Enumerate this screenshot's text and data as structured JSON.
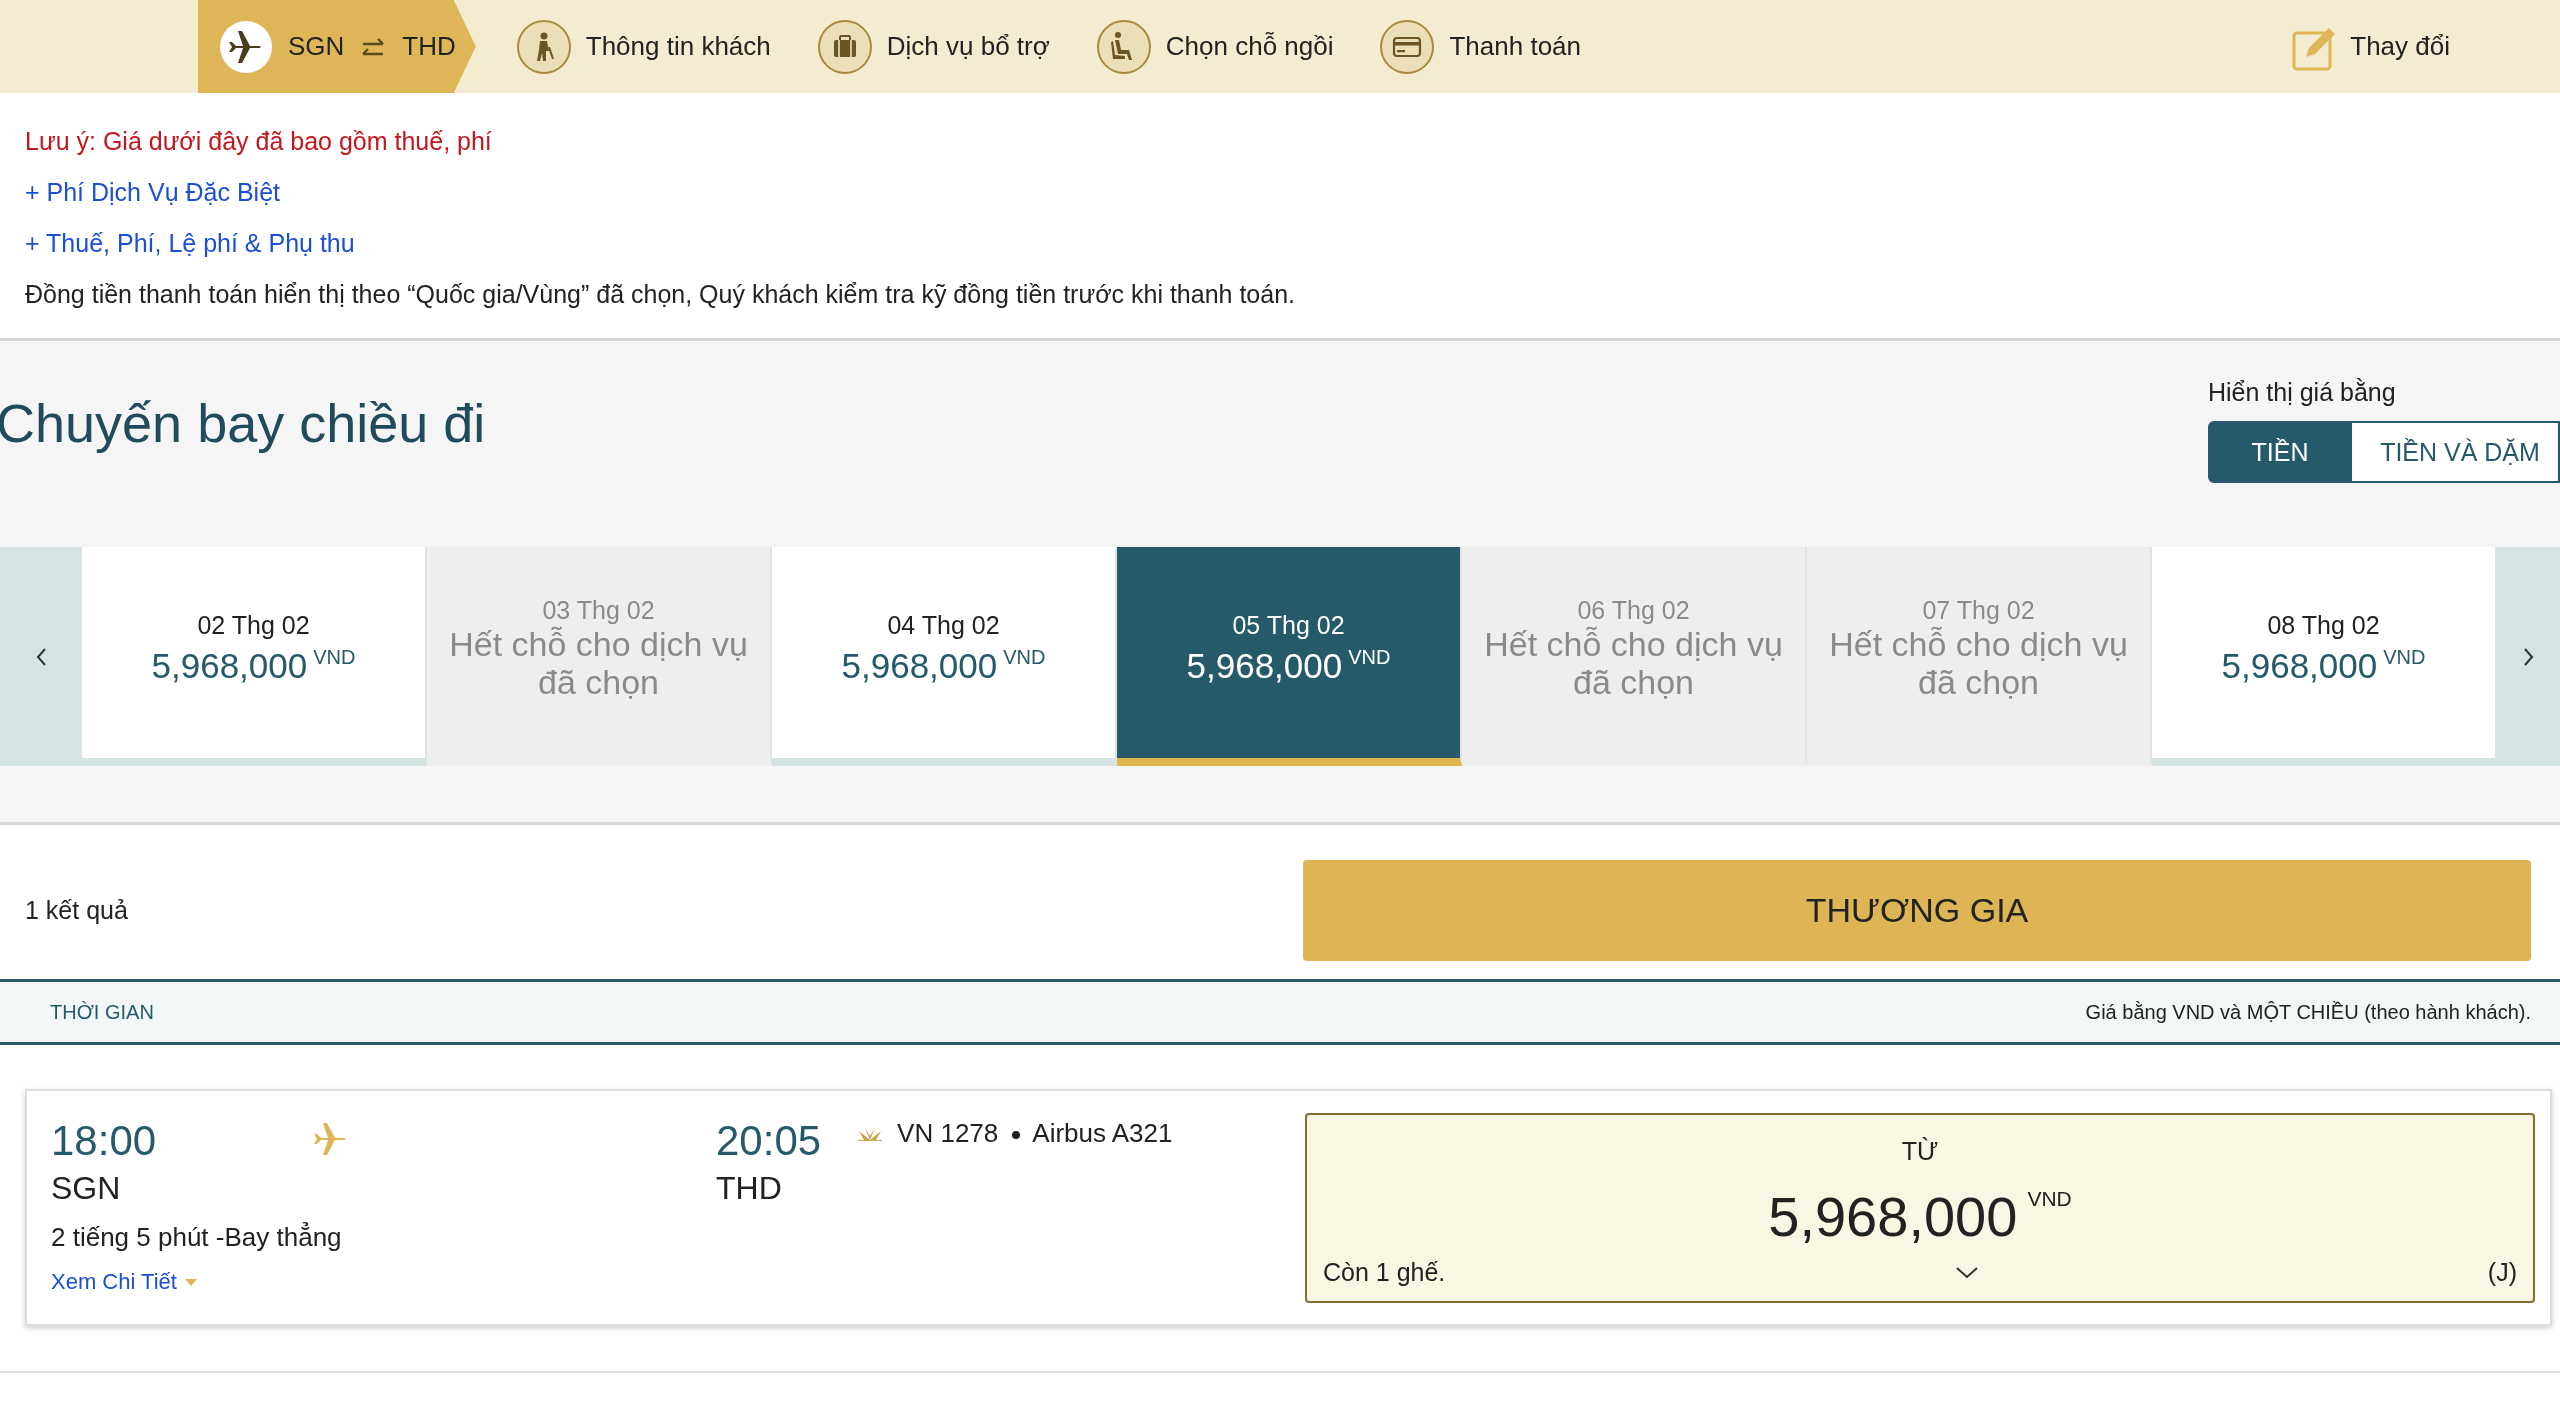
{
  "steps": {
    "route": {
      "from": "SGN",
      "to": "THD",
      "selected": true
    },
    "items": [
      {
        "kind": "passenger",
        "label": "Thông tin khách",
        "selected": false
      },
      {
        "kind": "baggage",
        "label": "Dịch vụ bổ trợ",
        "selected": false
      },
      {
        "kind": "seat",
        "label": "Chọn chỗ ngồi",
        "selected": false
      },
      {
        "kind": "payment",
        "label": "Thanh toán",
        "selected": false
      }
    ],
    "change": "Thay đổi"
  },
  "notes": [
    {
      "kind": "warning",
      "text": "Lưu ý: Giá dưới đây đã bao gồm thuế, phí"
    },
    {
      "kind": "link",
      "text": "+ Phí Dịch Vụ Đặc Biệt"
    },
    {
      "kind": "link",
      "text": "+ Thuế, Phí, Lệ phí & Phụ thu"
    },
    {
      "kind": "plain",
      "text": "Đồng tiền thanh toán hiển thị theo “Quốc gia/Vùng” đã chọn, Quý khách kiểm tra kỹ đồng tiền trước khi thanh toán."
    }
  ],
  "outbound": {
    "title": "Chuyến bay chiều đi",
    "price_display": {
      "label": "Hiển thị giá bằng",
      "options": [
        {
          "label": "TIỀN",
          "selected": true
        },
        {
          "label": "TIỀN VÀ DẶM",
          "selected": false
        }
      ]
    },
    "dates": [
      {
        "date": "02 Thg 02",
        "available": true,
        "price": "5,968,000",
        "currency": "VND",
        "selected": false
      },
      {
        "date": "03 Thg 02",
        "available": false,
        "message": "Hết chỗ cho dịch vụ đã chọn",
        "selected": false
      },
      {
        "date": "04 Thg 02",
        "available": true,
        "price": "5,968,000",
        "currency": "VND",
        "selected": false
      },
      {
        "date": "05 Thg 02",
        "available": true,
        "price": "5,968,000",
        "currency": "VND",
        "selected": true
      },
      {
        "date": "06 Thg 02",
        "available": false,
        "message": "Hết chỗ cho dịch vụ đã chọn",
        "selected": false
      },
      {
        "date": "07 Thg 02",
        "available": false,
        "message": "Hết chỗ cho dịch vụ đã chọn",
        "selected": false
      },
      {
        "date": "08 Thg 02",
        "available": true,
        "price": "5,968,000",
        "currency": "VND",
        "selected": false
      }
    ]
  },
  "results": {
    "count": "1 kết quả",
    "cabin": "THƯƠNG GIA",
    "columns": {
      "time": "THỜI GIAN",
      "note": "Giá bằng VND và MỘT CHIỀU (theo hành khách)."
    },
    "flights": [
      {
        "depart_time": "18:00",
        "depart_airport": "SGN",
        "arrive_time": "20:05",
        "arrive_airport": "THD",
        "flight": "VN 1278",
        "aircraft": "Airbus A321",
        "duration": "2 tiếng 5 phút -Bay thẳng",
        "details_link": "Xem Chi Tiết",
        "fare": {
          "from": "TỪ",
          "price": "5,968,000",
          "currency": "VND",
          "seats": "Còn 1 ghế.",
          "fare_class": "(J)"
        }
      }
    ]
  }
}
